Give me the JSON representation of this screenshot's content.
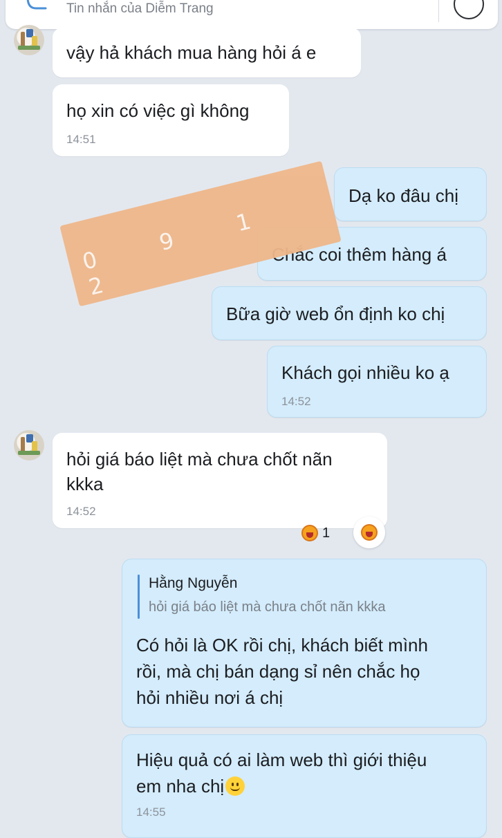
{
  "header": {
    "placeholder": "Tin nhắn của Diễm Trang"
  },
  "messages": [
    {
      "id": "m1",
      "text": "vậy hả khách mua hàng hỏi á e"
    },
    {
      "id": "m2",
      "text": "họ xin có việc gì không",
      "time": "14:51"
    },
    {
      "id": "m3",
      "text": "Dạ ko đâu chị"
    },
    {
      "id": "m4",
      "text": "Chắc coi thêm hàng á"
    },
    {
      "id": "m5",
      "text": "Bữa giờ web ổn định ko chị"
    },
    {
      "id": "m6",
      "text": "Khách gọi nhiều ko ạ",
      "time": "14:52"
    },
    {
      "id": "m7",
      "lines": [
        "hỏi giá báo liệt mà chưa chốt nãn",
        "kkka"
      ],
      "time": "14:52",
      "reaction": {
        "emoji": "laughing-emoji",
        "count": "1"
      }
    },
    {
      "id": "m8",
      "quote": {
        "name": "Hằng Nguyễn",
        "text": "hỏi giá báo liệt mà chưa chốt nãn kkka"
      },
      "lines": [
        "Có hỏi là OK rồi chị, khách biết mình",
        "rồi, mà chị bán dạng sỉ nên chắc họ",
        "hỏi nhiều nơi á chị"
      ]
    },
    {
      "id": "m9",
      "lines": [
        "Hiệu quả có ai làm web thì giới thiệu",
        "em nha chị"
      ],
      "time": "14:55"
    }
  ],
  "redaction": {
    "visible_digits": "0 9 1 2"
  },
  "colors": {
    "background": "#e3e8ef",
    "incoming_bubble": "#ffffff",
    "outgoing_bubble": "#d4ecfb",
    "quote_accent": "#4a8fd8",
    "redaction": "#efb78a"
  }
}
